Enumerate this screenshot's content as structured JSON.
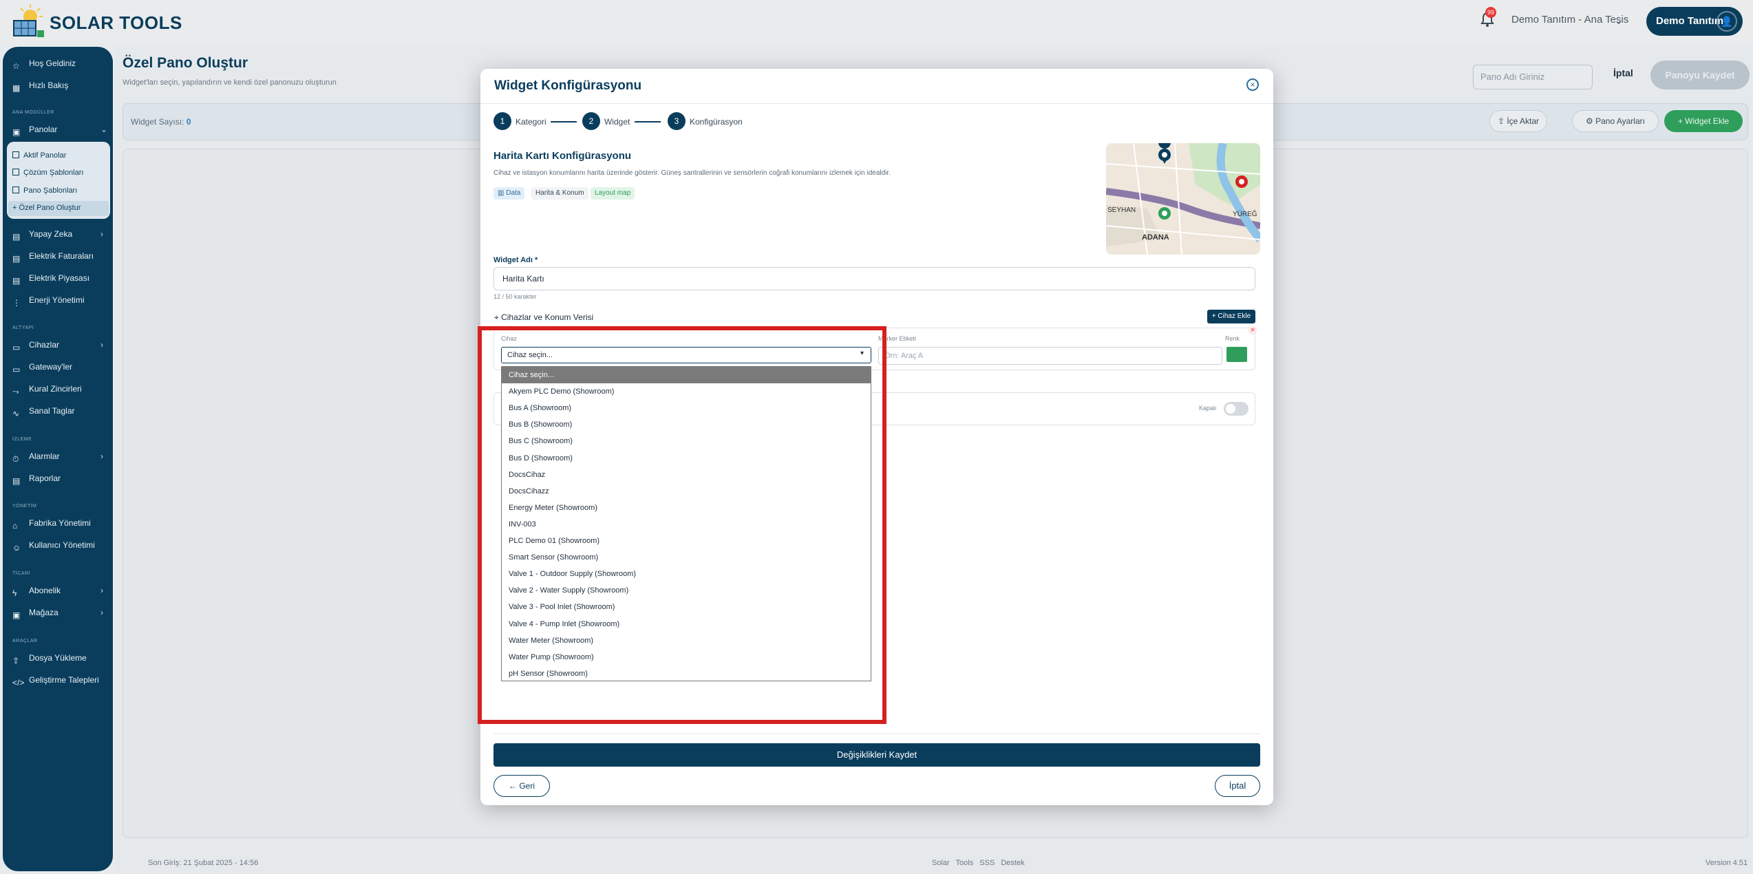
{
  "app": {
    "brand": "SOLAR TOOLS",
    "notifications": "99",
    "facility": "Demo Tanıtım - Ana Tesis",
    "user": "Demo Tanıtım"
  },
  "sidebar": {
    "top": [
      {
        "label": "Hoş Geldiniz",
        "icon": "star-icon"
      },
      {
        "label": "Hızlı Bakış",
        "icon": "grid-icon"
      }
    ],
    "sections": {
      "ana": "ANA MODÜLLER",
      "altyapi": "ALTYAPI",
      "izleme": "İZLEME",
      "yonetim": "YÖNETİM",
      "ticari": "TİCARİ",
      "araclar": "ARAÇLAR"
    },
    "panolar": "Panolar",
    "panolar_sub": [
      "Aktif Panolar",
      "Çözüm Şablonları",
      "Pano Şablonları",
      "Özel Pano Oluştur"
    ],
    "ana_items": [
      "Yapay Zeka",
      "Elektrik Faturaları",
      "Elektrik Piyasası",
      "Enerji Yönetimi"
    ],
    "altyapi_items": [
      "Cihazlar",
      "Gateway'ler",
      "Kural Zincirleri",
      "Sanal Taglar"
    ],
    "izleme_items": [
      "Alarmlar",
      "Raporlar"
    ],
    "yonetim_items": [
      "Fabrika Yönetimi",
      "Kullanıcı Yönetimi"
    ],
    "ticari_items": [
      "Abonelik",
      "Mağaza"
    ],
    "araclar_items": [
      "Dosya Yükleme",
      "Geliştirme Talepleri"
    ]
  },
  "page": {
    "title": "Özel Pano Oluştur",
    "subtitle": "Widget'ları seçin, yapılandırın ve kendi özel panonuzu oluşturun",
    "name_placeholder": "Pano Adı Giriniz",
    "cancel": "İptal",
    "save": "Panoyu Kaydet",
    "widget_count_label": "Widget Sayısı:",
    "widget_count": "0",
    "import": "İçe Aktar",
    "settings": "Pano Ayarları",
    "add_widget": "Widget Ekle"
  },
  "footer": {
    "last_login": "Son Giriş: 21 Şubat 2025 - 14:56",
    "links": "Solar Tools SSS Destek",
    "version": "Version 4.51"
  },
  "modal": {
    "title": "Widget Konfigürasyonu",
    "steps": [
      {
        "n": "1",
        "label": "Kategori"
      },
      {
        "n": "2",
        "label": "Widget"
      },
      {
        "n": "3",
        "label": "Konfigürasyon"
      }
    ],
    "cfg_title": "Harita Kartı Konfigürasyonu",
    "cfg_desc": "Cihaz ve istasyon konumlarını harita üzerinde gösterir. Güneş santrallerinin ve sensörlerin coğrafi konumlarını izlemek için idealdir.",
    "tags": [
      "Data",
      "Harita & Konum",
      "Layout map"
    ],
    "map_labels": [
      "SEYHAN",
      "ADANA",
      "YÜREĞ"
    ],
    "widget_name_label": "Widget Adı *",
    "widget_name": "Harita Kartı",
    "char_count": "12 / 50 karakter",
    "devices_header": "Cihazlar ve Konum Verisi",
    "add_device": "+ Cihaz Ekle",
    "col_device": "Cihaz",
    "col_marker": "Marker Etiketi",
    "col_color": "Renk",
    "marker_placeholder": "Örn: Araç A",
    "toggle_label": "Kapalı",
    "select_value": "Cihaz seçin...",
    "options": [
      "Cihaz seçin...",
      "Akyem PLC Demo (Showroom)",
      "Bus A (Showroom)",
      "Bus B (Showroom)",
      "Bus C (Showroom)",
      "Bus D (Showroom)",
      "DocsCihaz",
      "DocsCihazz",
      "Energy Meter (Showroom)",
      "INV-003",
      "PLC Demo 01 (Showroom)",
      "Smart Sensor (Showroom)",
      "Valve 1 - Outdoor Supply (Showroom)",
      "Valve 2 - Water Supply (Showroom)",
      "Valve 3 - Pool Inlet (Showroom)",
      "Valve 4 - Pump Inlet (Showroom)",
      "Water Meter (Showroom)",
      "Water Pump (Showroom)",
      "pH Sensor (Showroom)"
    ],
    "save_changes": "Değişiklikleri Kaydet",
    "back": "← Geri",
    "cancel": "İptal"
  },
  "colors": {
    "primary": "#0a3d5c",
    "success": "#2f9e5b",
    "highlight": "#d62020"
  }
}
